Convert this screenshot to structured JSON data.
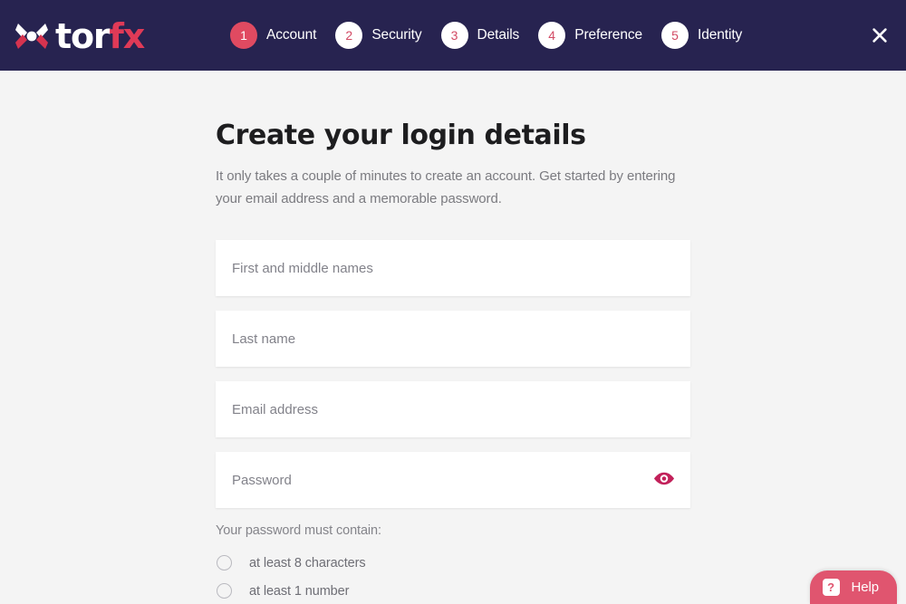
{
  "header": {
    "logo": {
      "mark_icon": "torfx-x-logo-icon",
      "word_primary": "tor",
      "word_accent": "fx",
      "accent_color": "#e03a57",
      "background_color": "#272350"
    },
    "close_icon": "close-icon",
    "steps": [
      {
        "number": "1",
        "label": "Account",
        "active": true
      },
      {
        "number": "2",
        "label": "Security",
        "active": false
      },
      {
        "number": "3",
        "label": "Details",
        "active": false
      },
      {
        "number": "4",
        "label": "Preference",
        "active": false
      },
      {
        "number": "5",
        "label": "Identity",
        "active": false
      }
    ]
  },
  "main": {
    "title": "Create your login details",
    "description": "It only takes a couple of minutes to create an account. Get started by entering your email address and a memorable password.",
    "fields": [
      {
        "name": "first-and-middle-names",
        "placeholder": "First and middle names",
        "value": "",
        "type": "text"
      },
      {
        "name": "last-name",
        "placeholder": "Last name",
        "value": "",
        "type": "text"
      },
      {
        "name": "email-address",
        "placeholder": "Email address",
        "value": "",
        "type": "email"
      },
      {
        "name": "password",
        "placeholder": "Password",
        "value": "",
        "type": "password"
      }
    ],
    "password_toggle_icon": "eye-icon",
    "password_toggle_color": "#c2215a",
    "password_rules": {
      "title": "Your password must contain:",
      "items": [
        {
          "label": "at least 8 characters",
          "met": false
        },
        {
          "label": "at least 1 number",
          "met": false
        }
      ]
    }
  },
  "help": {
    "icon": "question-mark-icon",
    "badge_text": "?",
    "label": "Help",
    "color": "#e0556f"
  },
  "theme": {
    "page_background": "#f4f4f4",
    "header_background": "#272350",
    "accent": "#e04a61",
    "field_background": "#ffffff"
  }
}
